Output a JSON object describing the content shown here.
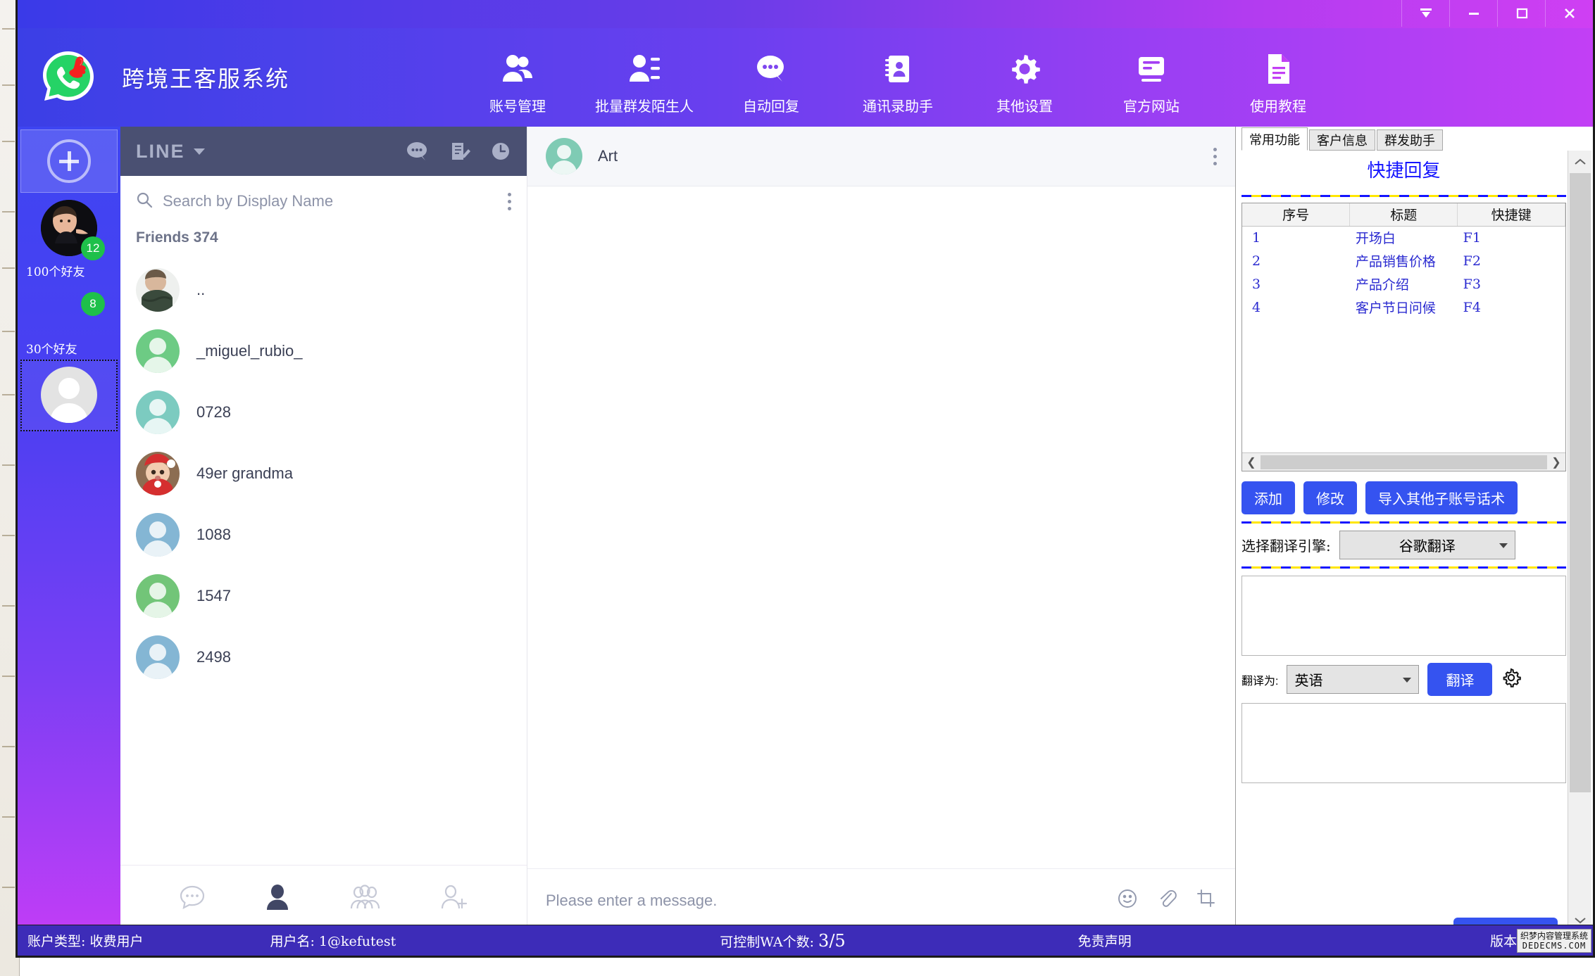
{
  "window": {
    "controls": [
      {
        "name": "collapse",
        "glyph": "collapse-icon"
      },
      {
        "name": "minimize",
        "glyph": "minimize-icon"
      },
      {
        "name": "maximize",
        "glyph": "maximize-icon"
      },
      {
        "name": "close",
        "glyph": "close-icon"
      }
    ]
  },
  "header": {
    "title": "跨境王客服系统",
    "logo_icon": "whatsapp-thumbsup-logo",
    "nav": [
      {
        "label": "账号管理",
        "icon": "users-icon"
      },
      {
        "label": "批量群发陌生人",
        "icon": "user-list-icon"
      },
      {
        "label": "自动回复",
        "icon": "chat-bubble-icon"
      },
      {
        "label": "通讯录助手",
        "icon": "contact-book-icon"
      },
      {
        "label": "其他设置",
        "icon": "gear-icon"
      },
      {
        "label": "官方网站",
        "icon": "window-icon"
      },
      {
        "label": "使用教程",
        "icon": "document-icon"
      }
    ]
  },
  "account_rail": {
    "add_label": "+",
    "accounts": [
      {
        "label": "100个好友",
        "badge": "12",
        "avatar": "photo-man"
      },
      {
        "label": "30个好友",
        "badge": "8",
        "avatar": "photo-hidden"
      },
      {
        "label": "",
        "badge": "",
        "avatar": "placeholder",
        "selected": true
      }
    ]
  },
  "contacts": {
    "platform": "LINE",
    "head_icons": [
      "chat-bubble-icon",
      "note-edit-icon",
      "clock-icon"
    ],
    "search_placeholder": "Search by Display Name",
    "friends_label": "Friends 374",
    "items": [
      {
        "name": "..",
        "avatar": "photo-scarf"
      },
      {
        "name": "_miguel_rubio_",
        "avatar": "green"
      },
      {
        "name": "0728",
        "avatar": "teal"
      },
      {
        "name": "49er grandma",
        "avatar": "photo-baby"
      },
      {
        "name": "1088",
        "avatar": "blue"
      },
      {
        "name": "1547",
        "avatar": "green2"
      },
      {
        "name": "2498",
        "avatar": "blue"
      }
    ],
    "toolbar": [
      {
        "icon": "chat-bubble-outline-icon",
        "active": false
      },
      {
        "icon": "person-filled-icon",
        "active": true
      },
      {
        "icon": "group-icon",
        "active": false
      },
      {
        "icon": "add-friend-icon",
        "active": false
      }
    ]
  },
  "chat": {
    "contact_name": "Art",
    "input_placeholder": "Please enter a message.",
    "input_icons": [
      "emoji-icon",
      "attachment-icon",
      "crop-icon"
    ]
  },
  "right_panel": {
    "tabs": [
      {
        "label": "常用功能",
        "active": true
      },
      {
        "label": "客户信息",
        "active": false
      },
      {
        "label": "群发助手",
        "active": false
      }
    ],
    "quick_reply": {
      "title": "快捷回复",
      "columns": [
        "序号",
        "标题",
        "快捷键"
      ],
      "rows": [
        {
          "num": "1",
          "title": "开场白",
          "key": "F1"
        },
        {
          "num": "2",
          "title": "产品销售价格",
          "key": "F2"
        },
        {
          "num": "3",
          "title": "产品介绍",
          "key": "F3"
        },
        {
          "num": "4",
          "title": "客户节日问候",
          "key": "F4"
        }
      ]
    },
    "buttons": {
      "add": "添加",
      "edit": "修改",
      "import": "导入其他子账号话术"
    },
    "engine": {
      "label": "选择翻译引擎:",
      "value": "谷歌翻译"
    },
    "translate": {
      "label": "翻译为:",
      "language": "英语",
      "button": "翻译",
      "settings_icon": "gear-icon"
    }
  },
  "statusbar": {
    "account_type": "账户类型: 收费用户",
    "username": "用户名: 1@kefutest",
    "wa_label": "可控制WA个数:",
    "wa_value": "3/5",
    "disclaimer": "免责声明",
    "version_prefix": "版本",
    "logo_line1": "织梦内容管理系统",
    "logo_line2": "DEDECMS.COM"
  }
}
